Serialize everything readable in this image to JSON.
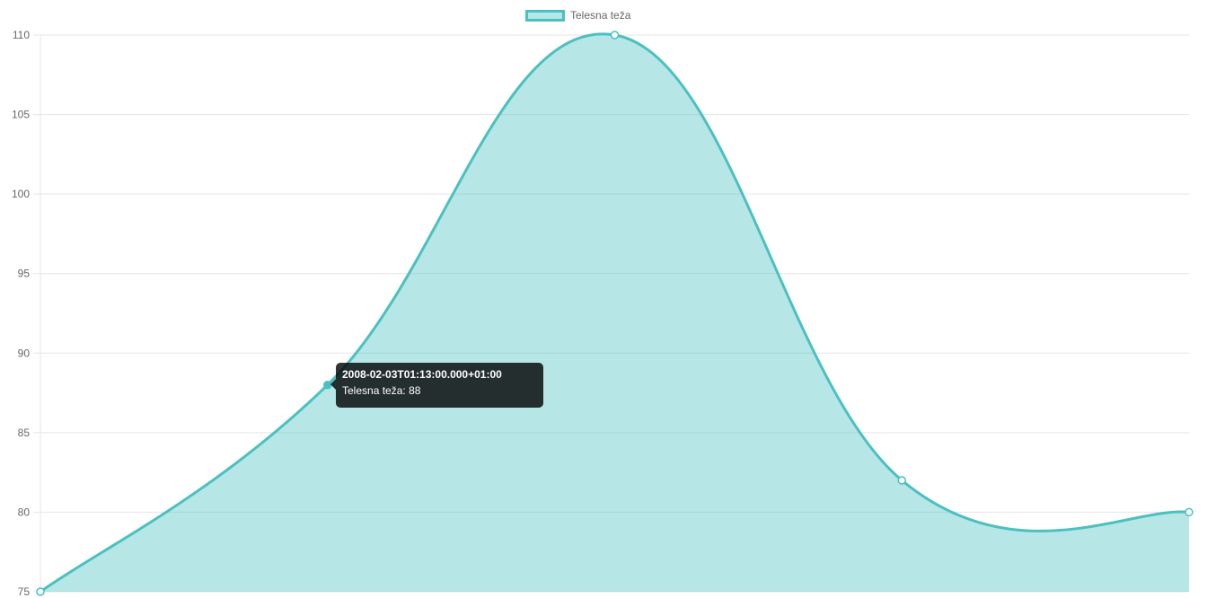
{
  "chart_data": {
    "type": "line",
    "fill": true,
    "smooth": true,
    "title": "",
    "xlabel": "",
    "ylabel": "",
    "ylim": [
      75,
      110
    ],
    "y_ticks": [
      75,
      80,
      85,
      90,
      95,
      100,
      105,
      110
    ],
    "grid": true,
    "legend_position": "top-center",
    "series": [
      {
        "name": "Telesna teža",
        "values": [
          75,
          88,
          110,
          82,
          80
        ],
        "color": "#4bc0c0",
        "fill_color": "rgba(75,192,192,0.4)"
      }
    ],
    "tooltip": {
      "title": "2008-02-03T01:13:00.000+01:00",
      "label": "Telesna teža",
      "value": "88",
      "point_index": 1
    }
  },
  "legend": {
    "label": "Telesna teža"
  }
}
